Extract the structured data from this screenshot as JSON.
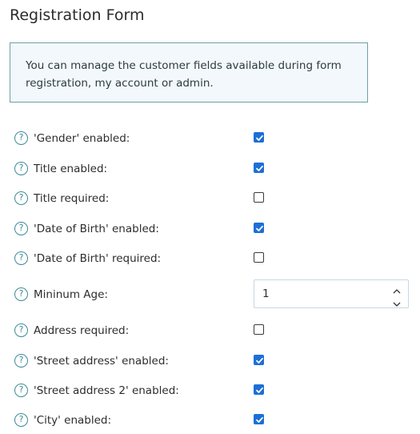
{
  "page": {
    "title": "Registration Form",
    "info_text": "You can manage the customer fields available during form registration, my account or admin."
  },
  "colors": {
    "accent": "#1d6fd6",
    "help_icon": "#3d8a98",
    "info_border": "#6f9fa8",
    "info_background": "#f2f8fb"
  },
  "fields": [
    {
      "label": "'Gender' enabled:",
      "type": "checkbox",
      "checked": true
    },
    {
      "label": "Title enabled:",
      "type": "checkbox",
      "checked": true
    },
    {
      "label": "Title required:",
      "type": "checkbox",
      "checked": false
    },
    {
      "label": "'Date of Birth' enabled:",
      "type": "checkbox",
      "checked": true
    },
    {
      "label": "'Date of Birth' required:",
      "type": "checkbox",
      "checked": false
    },
    {
      "label": "Mininum Age:",
      "type": "number",
      "value": "1"
    },
    {
      "label": "Address required:",
      "type": "checkbox",
      "checked": false
    },
    {
      "label": "'Street address' enabled:",
      "type": "checkbox",
      "checked": true
    },
    {
      "label": "'Street address 2' enabled:",
      "type": "checkbox",
      "checked": true
    },
    {
      "label": "'City' enabled:",
      "type": "checkbox",
      "checked": true
    }
  ],
  "icons": {
    "help": "question-circle-icon",
    "help_glyph": "?",
    "check": "checkmark-icon",
    "spin_up": "chevron-up-icon",
    "spin_down": "chevron-down-icon"
  }
}
